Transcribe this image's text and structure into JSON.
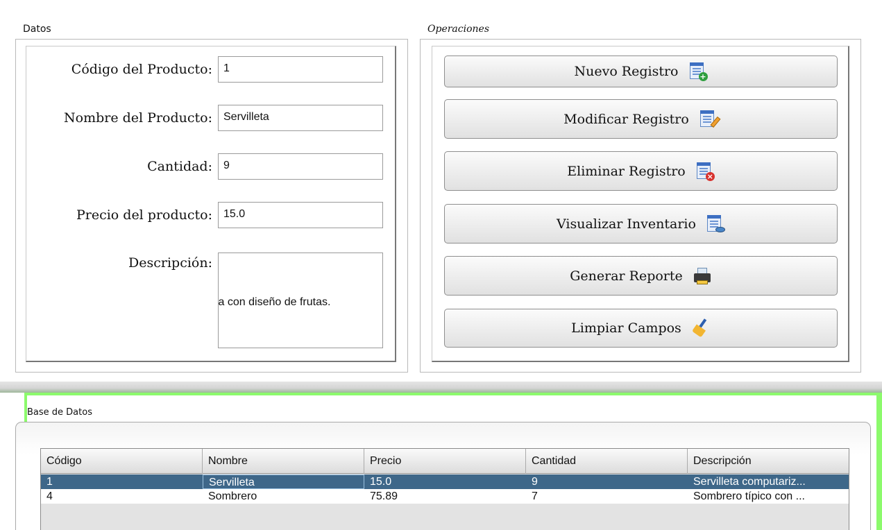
{
  "datos": {
    "title": "Datos",
    "fields": {
      "codigo": {
        "label": "Código del Producto:",
        "value": "1"
      },
      "nombre": {
        "label": "Nombre del Producto:",
        "value": "Servilleta"
      },
      "cantidad": {
        "label": "Cantidad:",
        "value": "9"
      },
      "precio": {
        "label": "Precio del producto:",
        "value": "15.0"
      },
      "descripcion": {
        "label": "Descripción:",
        "value": "la con diseño de frutas."
      }
    }
  },
  "operaciones": {
    "title": "Operaciones",
    "buttons": {
      "nuevo": "Nuevo Registro",
      "modificar": "Modificar Registro",
      "eliminar": "Eliminar Registro",
      "visualizar": "Visualizar Inventario",
      "reporte": "Generar Reporte",
      "limpiar": "Limpiar Campos"
    },
    "icons": [
      "document-add-icon",
      "document-edit-icon",
      "document-delete-icon",
      "document-view-icon",
      "printer-icon",
      "broom-icon"
    ]
  },
  "base_datos": {
    "title": "Base de Datos",
    "columns": [
      "Código",
      "Nombre",
      "Precio",
      "Cantidad",
      "Descripción"
    ],
    "rows": [
      [
        "1",
        "Servilleta",
        "15.0",
        "9",
        "Servilleta computariz..."
      ],
      [
        "4",
        "Sombrero",
        "75.89",
        "7",
        "Sombrero típico con ..."
      ]
    ],
    "selected_row_color": "#3e6789",
    "accent_border_color": "#8cfa6c"
  }
}
